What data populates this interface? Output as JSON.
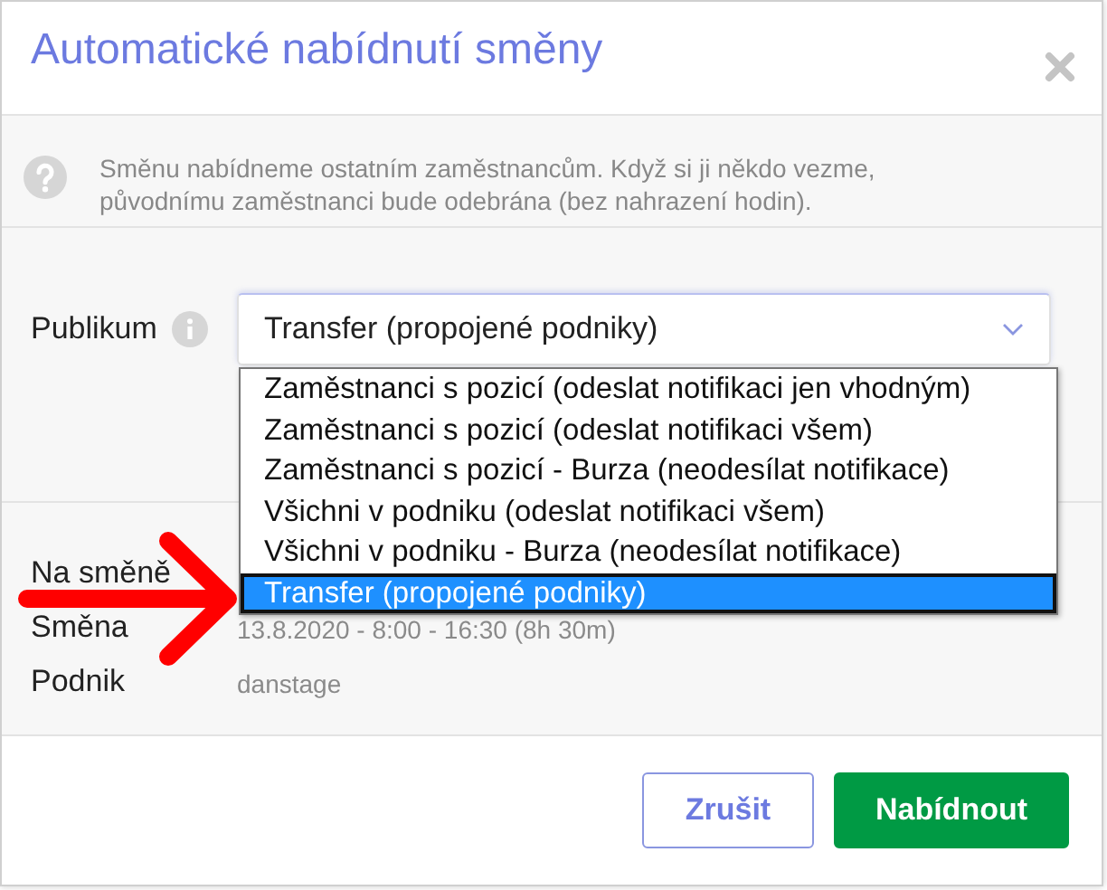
{
  "dialog": {
    "title": "Automatické nabídnutí směny",
    "info": "Směnu nabídneme ostatním zaměstnancům. Když si ji někdo vezme, původnímu zaměstnanci bude odebrána (bez nahrazení hodin).",
    "field": {
      "label": "Publikum",
      "value": "Transfer (propojené podniky)",
      "expanded": true,
      "options": [
        {
          "label": "Zaměstnanci s pozicí (odeslat notifikaci jen vhodným)",
          "selected": false
        },
        {
          "label": "Zaměstnanci s pozicí (odeslat notifikaci všem)",
          "selected": false
        },
        {
          "label": "Zaměstnanci s pozicí - Burza (neodesílat notifikace)",
          "selected": false
        },
        {
          "label": "Všichni v podniku (odeslat notifikaci všem)",
          "selected": false
        },
        {
          "label": "Všichni v podniku - Burza (neodesílat notifikace)",
          "selected": false
        },
        {
          "label": "Transfer (propojené podniky)",
          "selected": true
        }
      ]
    },
    "details": [
      {
        "label": "Na směně"
      },
      {
        "label": "Směna",
        "value": "13.8.2020 - 8:00 - 16:30  (8h 30m)"
      },
      {
        "label": "Podnik",
        "value": "danstage"
      }
    ],
    "buttons": [
      {
        "label": "Zrušit",
        "kind": "secondary"
      },
      {
        "label": "Nabídnout",
        "kind": "primary"
      }
    ]
  }
}
